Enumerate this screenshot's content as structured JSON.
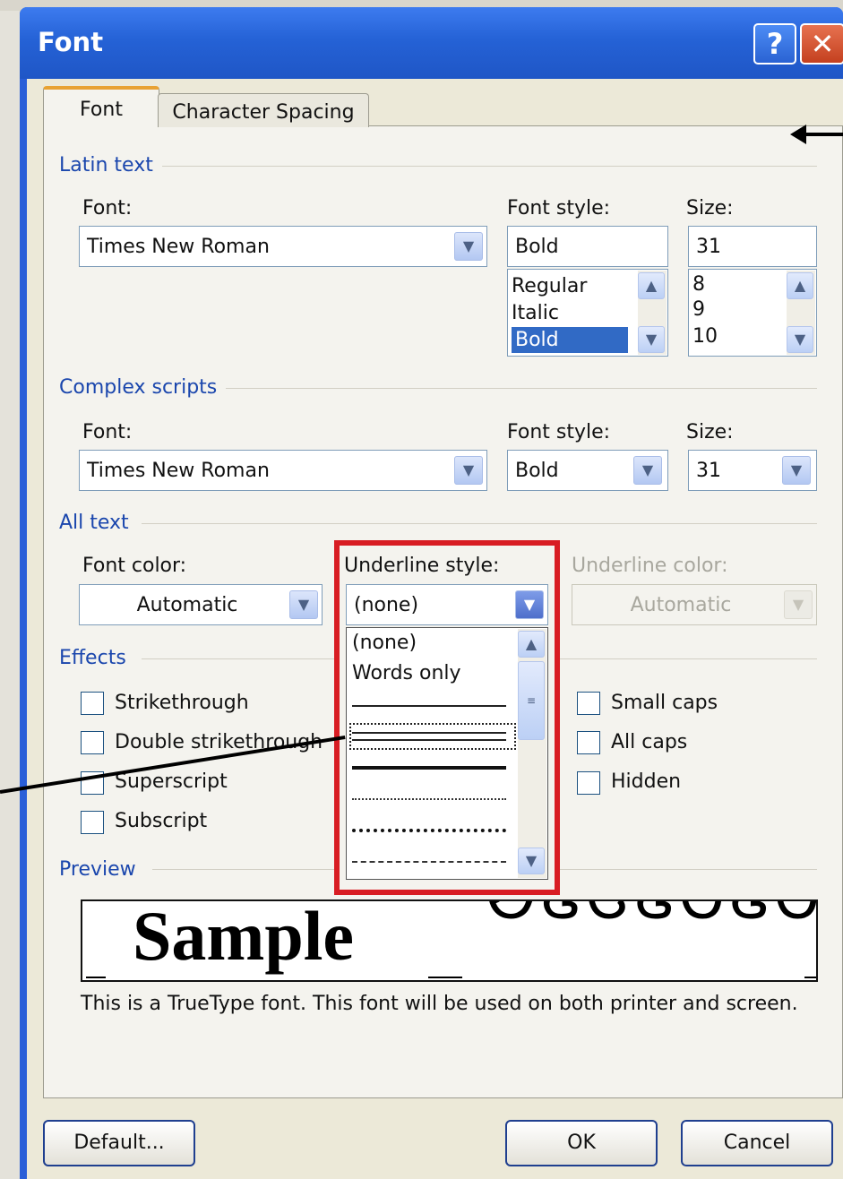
{
  "dialog": {
    "title": "Font",
    "help_glyph": "?",
    "close_glyph": "✕"
  },
  "tabs": [
    {
      "label": "Font",
      "active": true
    },
    {
      "label": "Character Spacing",
      "active": false
    }
  ],
  "latin": {
    "section_label": "Latin text",
    "font_label": "Font:",
    "font_value": "Times New Roman",
    "style_label": "Font style:",
    "style_value": "Bold",
    "style_options": [
      "Regular",
      "Italic",
      "Bold"
    ],
    "style_selected": "Bold",
    "size_label": "Size:",
    "size_value": "31",
    "size_options": [
      "8",
      "9",
      "10"
    ]
  },
  "complex": {
    "section_label": "Complex scripts",
    "font_label": "Font:",
    "font_value": "Times New Roman",
    "style_label": "Font style:",
    "style_value": "Bold",
    "size_label": "Size:",
    "size_value": "31"
  },
  "all_text": {
    "section_label": "All text",
    "font_color_label": "Font color:",
    "font_color_value": "Automatic",
    "underline_style_label": "Underline style:",
    "underline_style_value": "(none)",
    "underline_color_label": "Underline color:",
    "underline_color_value": "Automatic",
    "underline_options": [
      "(none)",
      "Words only"
    ]
  },
  "effects": {
    "section_label": "Effects",
    "left": [
      "Strikethrough",
      "Double strikethrough",
      "Superscript",
      "Subscript"
    ],
    "right": [
      "Small caps",
      "All caps",
      "Hidden"
    ]
  },
  "preview": {
    "section_label": "Preview",
    "sample_text": "Sample",
    "complex_text": "ᏬᏋᏣᏋᏟᏋᏟ",
    "note": "This is a TrueType font. This font will be used on both printer and screen."
  },
  "buttons": {
    "default": "Default...",
    "ok": "OK",
    "cancel": "Cancel"
  },
  "icons": {
    "dropdown": "chevron-down-icon",
    "scroll_up": "chevron-up-icon",
    "scroll_down": "chevron-down-icon",
    "grip": "scroll-grip-icon"
  },
  "colors": {
    "titlebar": "#2562d6",
    "section_text": "#1a46ad",
    "highlight": "#d81d23",
    "selection": "#316ac5"
  }
}
